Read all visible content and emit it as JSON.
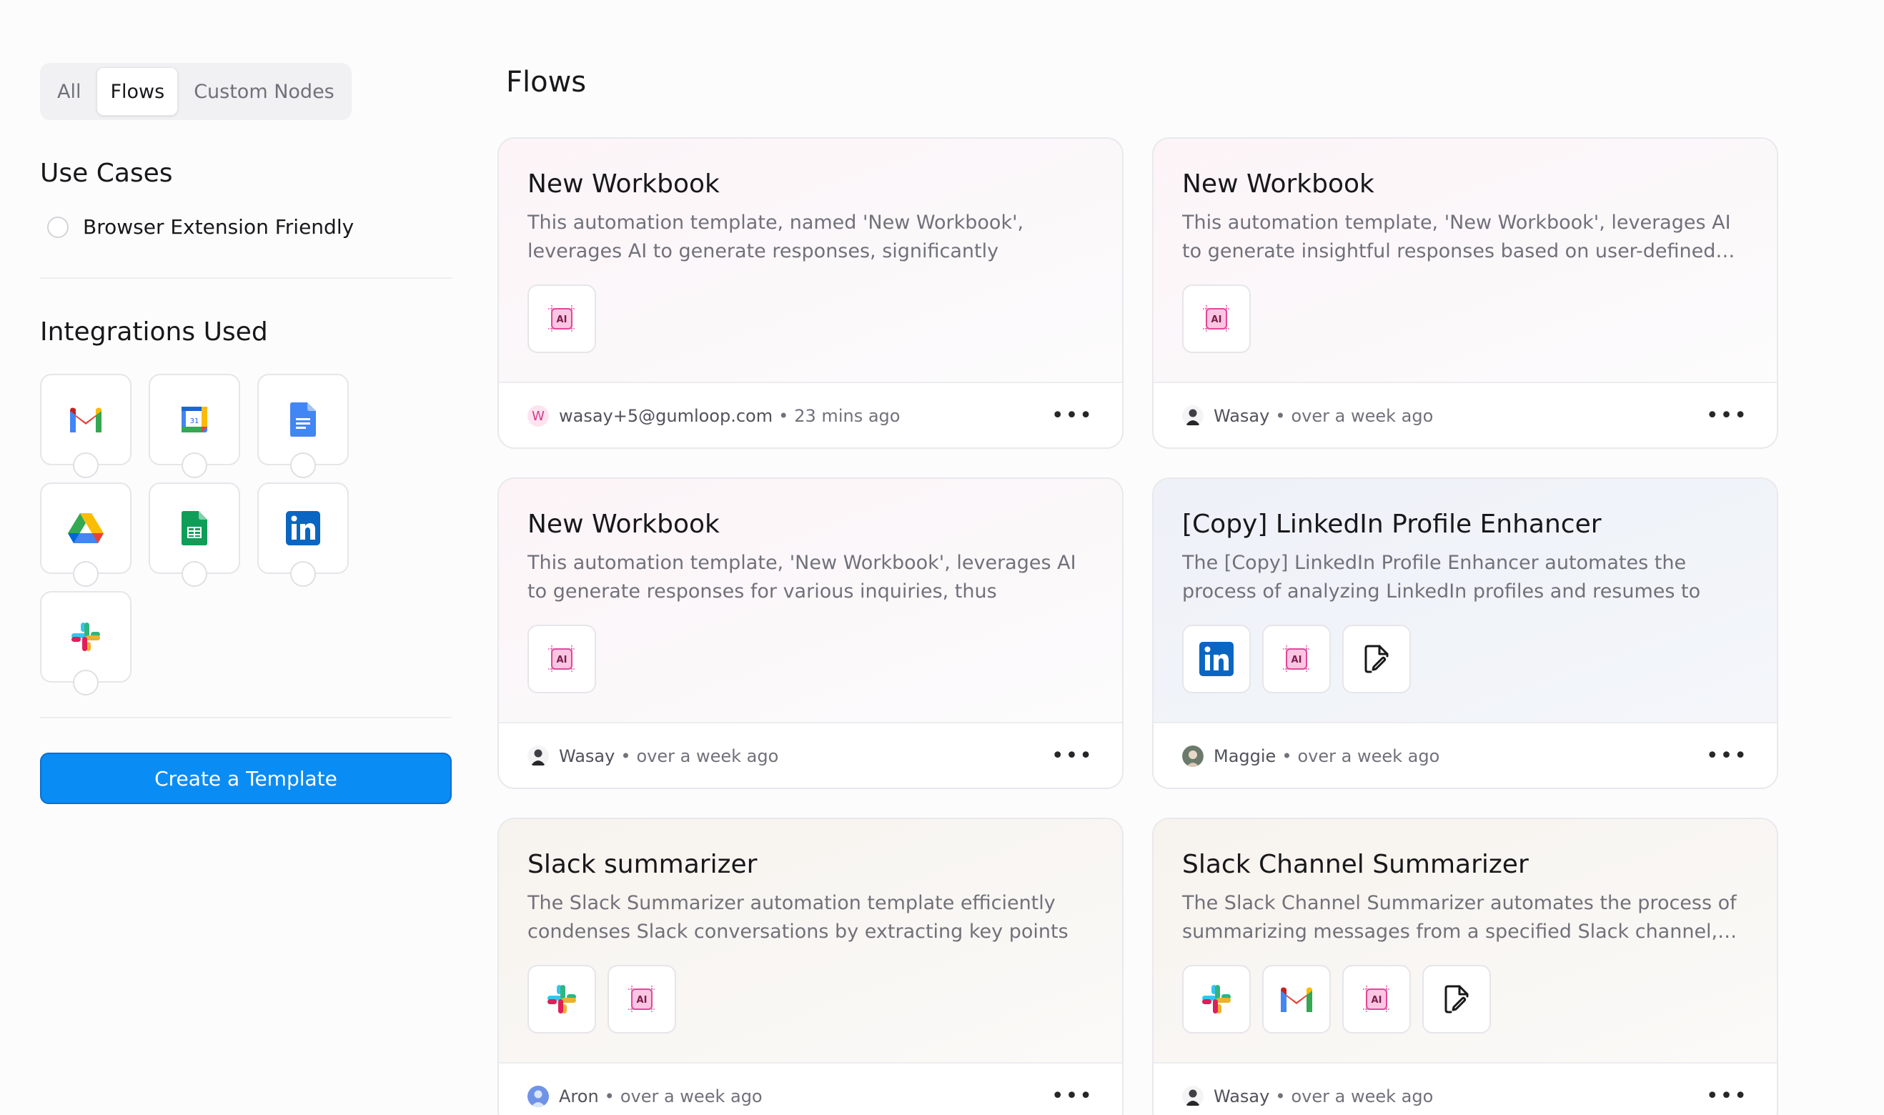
{
  "tabs": [
    {
      "label": "All",
      "active": false
    },
    {
      "label": "Flows",
      "active": true
    },
    {
      "label": "Custom Nodes",
      "active": false
    }
  ],
  "sidebar": {
    "use_cases_heading": "Use Cases",
    "use_case_option": "Browser Extension Friendly",
    "integrations_heading": "Integrations Used",
    "integrations": [
      "gmail-icon",
      "google-calendar-icon",
      "google-docs-icon",
      "google-drive-icon",
      "google-sheets-icon",
      "linkedin-icon",
      "slack-icon"
    ],
    "create_button": "Create a Template"
  },
  "main": {
    "title": "Flows",
    "cards": [
      {
        "title": "New Workbook",
        "description": "This automation template, named 'New Workbook', leverages AI to generate responses, significantly improving decision-…",
        "icons": [
          "ai-chip-icon"
        ],
        "author": "wasay+5@gumloop.com",
        "avatar_initial": "W",
        "time": "23 mins ago",
        "theme": "pink"
      },
      {
        "title": "New Workbook",
        "description": "This automation template, 'New Workbook', leverages AI to generate insightful responses based on user-defined…",
        "icons": [
          "ai-chip-icon"
        ],
        "author": "Wasay",
        "time": "over a week ago",
        "theme": "pink"
      },
      {
        "title": "New Workbook",
        "description": "This automation template, 'New Workbook', leverages AI to generate responses for various inquiries, thus enhancing…",
        "icons": [
          "ai-chip-icon"
        ],
        "author": "Wasay",
        "time": "over a week ago",
        "theme": "pink"
      },
      {
        "title": "[Copy] LinkedIn Profile Enhancer",
        "description": "The [Copy] LinkedIn Profile Enhancer automates the process of analyzing LinkedIn profiles and resumes to provide…",
        "icons": [
          "linkedin-icon",
          "ai-chip-icon",
          "file-signature-icon"
        ],
        "author": "Maggie",
        "time": "over a week ago",
        "theme": "blue"
      },
      {
        "title": "Slack summarizer",
        "description": "The Slack Summarizer automation template efficiently condenses Slack conversations by extracting key points an…",
        "icons": [
          "slack-icon",
          "ai-chip-icon"
        ],
        "author": "Aron",
        "time": "over a week ago",
        "theme": "beige"
      },
      {
        "title": "Slack Channel Summarizer",
        "description": "The Slack Channel Summarizer automates the process of summarizing messages from a specified Slack channel,…",
        "icons": [
          "slack-icon",
          "gmail-icon",
          "ai-chip-icon",
          "file-signature-icon"
        ],
        "author": "Wasay",
        "time": "over a week ago",
        "theme": "beige"
      }
    ],
    "more_label": "•••",
    "separator": "•"
  },
  "colors": {
    "accent": "#0a8cf5",
    "muted_text": "#71717a",
    "ai_pink": "#e3479b"
  }
}
